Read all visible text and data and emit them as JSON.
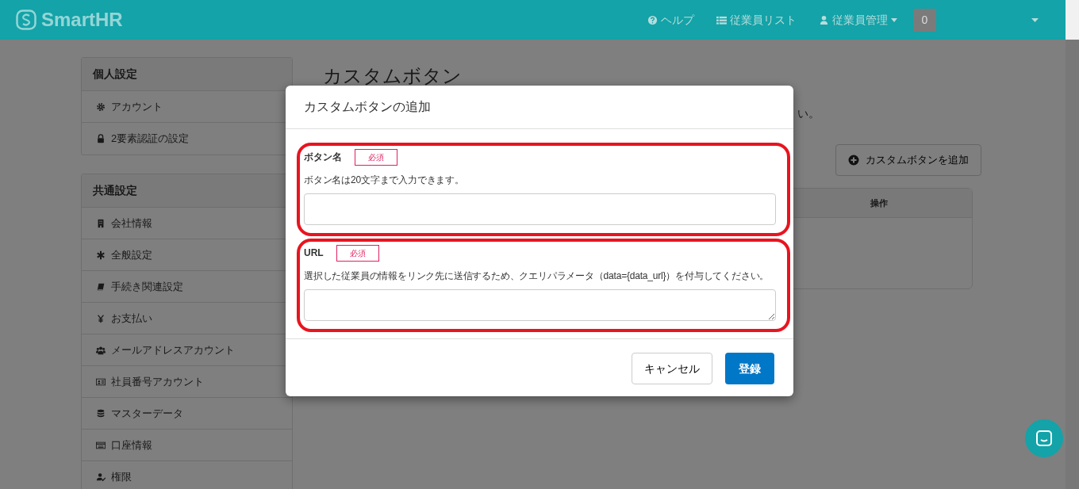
{
  "navbar": {
    "brand": "SmartHR",
    "links": [
      {
        "kind": "help",
        "label": "ヘルプ",
        "caret": false
      },
      {
        "kind": "list",
        "label": "従業員リスト",
        "caret": false
      },
      {
        "kind": "user",
        "label": "従業員管理",
        "caret": true
      }
    ],
    "count": "0"
  },
  "sidebar": [
    {
      "title": "個人設定",
      "items": [
        {
          "kind": "gear",
          "label": "アカウント"
        },
        {
          "kind": "lock",
          "label": "2要素認証の設定"
        }
      ]
    },
    {
      "title": "共通設定",
      "items": [
        {
          "kind": "building",
          "label": "会社情報"
        },
        {
          "kind": "asterisk",
          "label": "全般設定"
        },
        {
          "kind": "book",
          "label": "手続き関連設定"
        },
        {
          "kind": "yen",
          "label": "お支払い"
        },
        {
          "kind": "users",
          "label": "メールアドレスアカウント"
        },
        {
          "kind": "idcard",
          "label": "社員番号アカウント"
        },
        {
          "kind": "database",
          "label": "マスターデータ"
        },
        {
          "kind": "card",
          "label": "口座情報"
        },
        {
          "kind": "usercheck",
          "label": "権限"
        }
      ]
    }
  ],
  "page": {
    "title": "カスタムボタン",
    "note": "い。",
    "add_button": "カスタムボタンを追加",
    "table": {
      "columns": [
        "操作"
      ]
    }
  },
  "modal": {
    "title": "カスタムボタンの追加",
    "fields": [
      {
        "kind": "input",
        "label": "ボタン名",
        "badge": "必須",
        "help": "ボタン名は20文字まで入力できます。",
        "highlighted": true
      },
      {
        "kind": "textarea",
        "label": "URL",
        "badge": "必須",
        "help": "選択した従業員の情報をリンク先に送信するため、クエリパラメータ（data={data_url}）を付与してください。",
        "highlighted": true
      }
    ],
    "buttons": [
      {
        "kind": "secondary",
        "label": "キャンセル"
      },
      {
        "kind": "primary",
        "label": "登録"
      }
    ]
  }
}
